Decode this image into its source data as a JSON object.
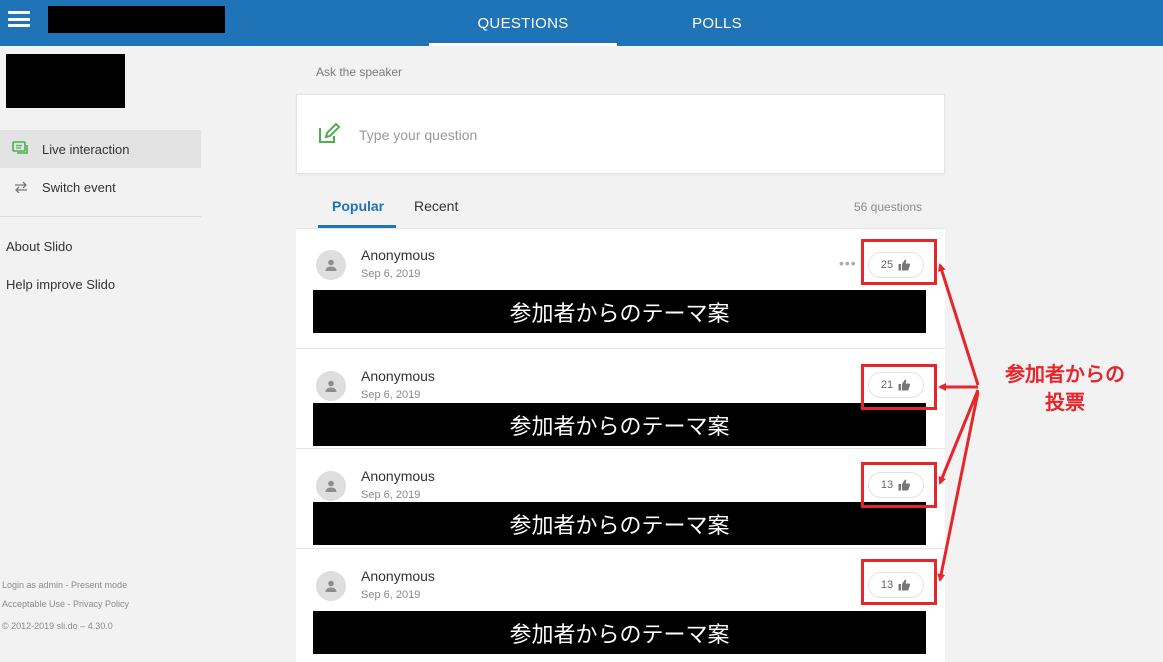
{
  "header": {
    "tabs": [
      {
        "label": "QUESTIONS",
        "active": true
      },
      {
        "label": "POLLS",
        "active": false
      }
    ]
  },
  "sidebar": {
    "items": [
      {
        "label": "Live interaction",
        "icon": "chat-icon",
        "active": true
      },
      {
        "label": "Switch event",
        "icon": "switch-arrows-icon",
        "active": false
      }
    ],
    "links": [
      "About Slido",
      "Help improve Slido"
    ],
    "footer": {
      "login": "Login as admin - Present mode",
      "legal": "Acceptable Use - Privacy Policy",
      "copyright": "© 2012-2019 sli.do – 4.30.0"
    }
  },
  "ask": {
    "label": "Ask the speaker",
    "placeholder": "Type your question"
  },
  "sort": {
    "popular": "Popular",
    "recent": "Recent",
    "count": "56 questions"
  },
  "questions": [
    {
      "author": "Anonymous",
      "date": "Sep 6, 2019",
      "text": "参加者からのテーマ案",
      "likes": "25"
    },
    {
      "author": "Anonymous",
      "date": "Sep 6, 2019",
      "text": "参加者からのテーマ案",
      "likes": "21"
    },
    {
      "author": "Anonymous",
      "date": "Sep 6, 2019",
      "text": "参加者からのテーマ案",
      "likes": "13"
    },
    {
      "author": "Anonymous",
      "date": "Sep 6, 2019",
      "text": "参加者からのテーマ案",
      "likes": "13"
    }
  ],
  "annotation": {
    "line1": "参加者からの",
    "line2": "投票",
    "color": "#e5262b"
  },
  "colors": {
    "brand": "#1f73b7",
    "accent_green": "#4caf50"
  }
}
